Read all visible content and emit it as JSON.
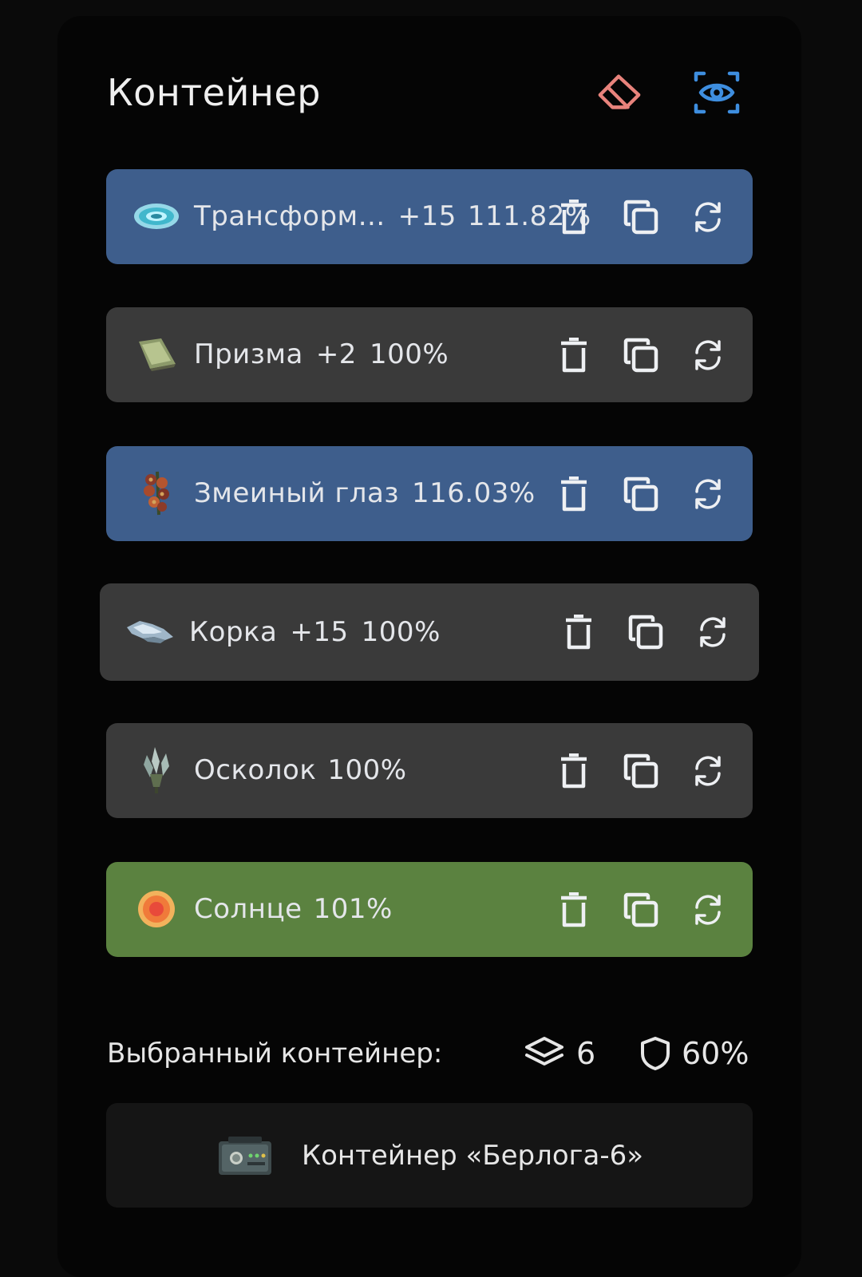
{
  "header": {
    "title": "Контейнер",
    "eraser_icon": "eraser-icon",
    "eye_icon": "eye-scan-icon",
    "eraser_color": "#e8837c",
    "eye_color": "#3e8edf"
  },
  "items": [
    {
      "name": "Трансформ...",
      "level": "+15",
      "percent": "111.82%",
      "color": "#3e5e8c"
    },
    {
      "name": "Призма",
      "level": "+2",
      "percent": "100%",
      "color": "#3a3a3a"
    },
    {
      "name": "Змеиный глаз",
      "level": "",
      "percent": "116.03%",
      "color": "#3e5e8c"
    },
    {
      "name": "Корка",
      "level": "+15",
      "percent": "100%",
      "color": "#3a3a3a"
    },
    {
      "name": "Осколок",
      "level": "",
      "percent": "100%",
      "color": "#3a3a3a"
    },
    {
      "name": "Солнце",
      "level": "",
      "percent": "101%",
      "color": "#5b8240"
    }
  ],
  "item_actions": [
    "trash-icon",
    "copy-icon",
    "refresh-icon"
  ],
  "selected": {
    "label": "Выбранный контейнер:",
    "slots": "6",
    "protection": "60%"
  },
  "container": {
    "name": "Контейнер «Берлога-6»"
  }
}
